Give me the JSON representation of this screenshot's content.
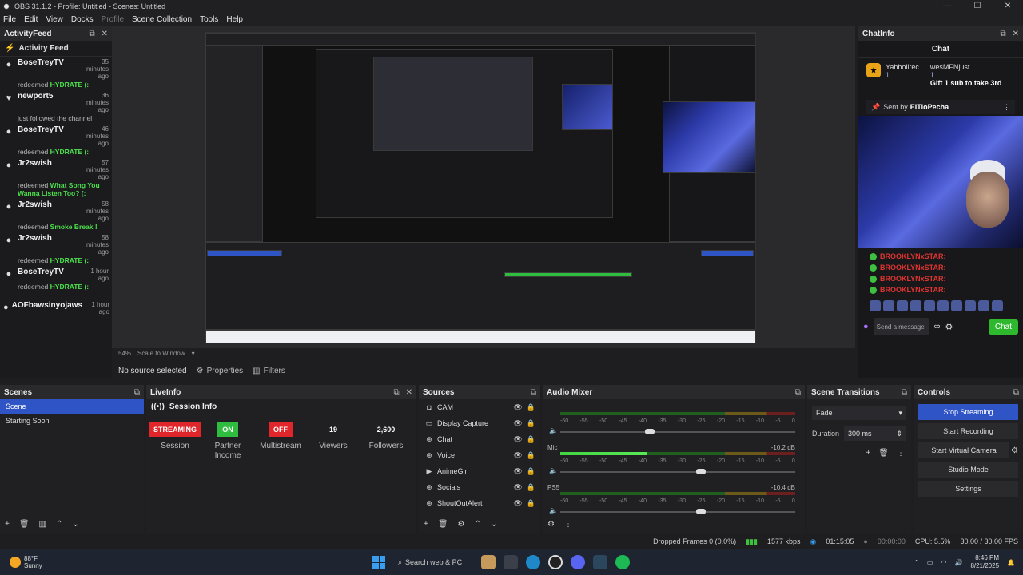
{
  "window": {
    "title": "OBS 31.1.2 - Profile: Untitled - Scenes: Untitled",
    "controls": [
      "—",
      "☐",
      "✕"
    ]
  },
  "menu": [
    "File",
    "Edit",
    "View",
    "Docks",
    "Profile",
    "Scene Collection",
    "Tools",
    "Help"
  ],
  "activity_feed": {
    "dock_title": "ActivityFeed",
    "header": "Activity Feed",
    "items": [
      {
        "icon": "person-icon",
        "name": "BoseTreyTV",
        "time": "35 minutes ago",
        "action_prefix": "redeemed",
        "highlight": "HYDRATE (:"
      },
      {
        "icon": "heart-icon",
        "name": "newport5",
        "time": "36 minutes ago",
        "action_prefix": "just followed the channel",
        "highlight": ""
      },
      {
        "icon": "person-icon",
        "name": "BoseTreyTV",
        "time": "46 minutes ago",
        "action_prefix": "redeemed",
        "highlight": "HYDRATE (:"
      },
      {
        "icon": "person-icon",
        "name": "Jr2swish",
        "time": "57 minutes ago",
        "action_prefix": "redeemed",
        "highlight": "What Song You Wanna Listen Too? (:"
      },
      {
        "icon": "person-icon",
        "name": "Jr2swish",
        "time": "58 minutes ago",
        "action_prefix": "redeemed",
        "highlight": "Smoke Break !"
      },
      {
        "icon": "person-icon",
        "name": "Jr2swish",
        "time": "58 minutes ago",
        "action_prefix": "redeemed",
        "highlight": "HYDRATE (:"
      },
      {
        "icon": "person-icon",
        "name": "BoseTreyTV",
        "time": "1 hour ago",
        "action_prefix": "redeemed",
        "highlight": "HYDRATE (:"
      },
      {
        "icon": "person-icon",
        "name": "AOFbawsinyojaws",
        "time": "1 hour ago",
        "action_prefix": "",
        "highlight": ""
      }
    ]
  },
  "preview_bar": {
    "zoom": "54%",
    "scale_mode": "Scale to Window"
  },
  "source_bar": {
    "status": "No source selected",
    "properties": "Properties",
    "filters": "Filters"
  },
  "chat": {
    "dock_title": "ChatInfo",
    "header": "Chat",
    "gift_user": "Yahboiirec",
    "gift_count": "1",
    "gift_sender": "wesMFNjust",
    "gift_sender_count": "1",
    "gift_text": "Gift 1 sub to take 3rd",
    "sent_by_prefix": "Sent by",
    "sent_by_name": "ElTioPecha",
    "messages": [
      "BROOKLYNxSTAR:",
      "BROOKLYNxSTAR:",
      "BROOKLYNxSTAR:",
      "BROOKLYNxSTAR:"
    ],
    "send_placeholder": "Send a message",
    "send_button": "Chat"
  },
  "scenes": {
    "title": "Scenes",
    "items": [
      {
        "name": "Scene",
        "selected": true
      },
      {
        "name": "Starting Soon",
        "selected": false
      }
    ]
  },
  "liveinfo": {
    "title": "LiveInfo",
    "session_title": "Session Info",
    "stats": [
      {
        "value": "STREAMING",
        "label": "Session",
        "style": "red"
      },
      {
        "value": "ON",
        "label": "Partner Income",
        "style": "green"
      },
      {
        "value": "OFF",
        "label": "Multistream",
        "style": "red"
      },
      {
        "value": "19",
        "label": "Viewers",
        "style": "plain"
      },
      {
        "value": "2,600",
        "label": "Followers",
        "style": "plain"
      }
    ]
  },
  "sources": {
    "title": "Sources",
    "items": [
      {
        "name": "CAM",
        "icon": "camera-icon"
      },
      {
        "name": "Display Capture",
        "icon": "monitor-icon"
      },
      {
        "name": "Chat",
        "icon": "globe-icon"
      },
      {
        "name": "Voice",
        "icon": "globe-icon"
      },
      {
        "name": "AnimeGirl",
        "icon": "play-icon"
      },
      {
        "name": "Socials",
        "icon": "globe-icon"
      },
      {
        "name": "ShoutOutAlert",
        "icon": "globe-icon"
      }
    ]
  },
  "audio_mixer": {
    "title": "Audio Mixer",
    "scale": [
      "-60",
      "-55",
      "-50",
      "-45",
      "-40",
      "-35",
      "-30",
      "-25",
      "-20",
      "-15",
      "-10",
      "-5",
      "0"
    ],
    "channels": [
      {
        "name": "",
        "db": "",
        "level": 0.0,
        "fader": 0.38
      },
      {
        "name": "Mic",
        "db": "-10.2 dB",
        "level": 0.37,
        "fader": 0.6
      },
      {
        "name": "PS5",
        "db": "-10.4 dB",
        "level": 0.0,
        "fader": 0.6
      }
    ]
  },
  "transitions": {
    "title": "Scene Transitions",
    "selected": "Fade",
    "duration_label": "Duration",
    "duration_value": "300 ms"
  },
  "controls": {
    "title": "Controls",
    "buttons": [
      {
        "label": "Stop Streaming",
        "active": true
      },
      {
        "label": "Start Recording",
        "active": false
      },
      {
        "label": "Start Virtual Camera",
        "active": false
      },
      {
        "label": "Studio Mode",
        "active": false
      },
      {
        "label": "Settings",
        "active": false
      }
    ]
  },
  "statusbar": {
    "dropped": "Dropped Frames 0 (0.0%)",
    "bitrate": "1577 kbps",
    "live_time": "01:15:05",
    "rec_time": "00:00:00",
    "cpu": "CPU: 5.5%",
    "fps": "30.00 / 30.00 FPS"
  },
  "taskbar": {
    "temp": "88°F",
    "condition": "Sunny",
    "search": "Search web & PC",
    "time": "8:46 PM",
    "date": "8/21/2025"
  },
  "colors": {
    "accent": "#2f54c6",
    "streaming_red": "#e0262b",
    "on_green": "#2fbd3f",
    "redeem_green": "#4ce04c",
    "chat_name_red": "#e0342f"
  }
}
